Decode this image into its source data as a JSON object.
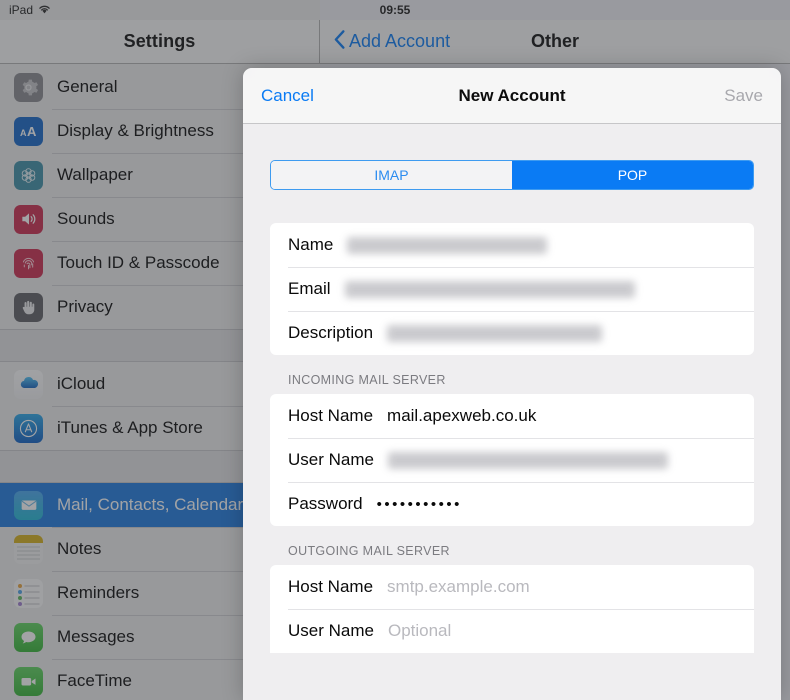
{
  "statusbar": {
    "device": "iPad",
    "wifi_icon": "wifi-icon",
    "time": "09:55"
  },
  "sidebar": {
    "title": "Settings",
    "groups": [
      {
        "items": [
          {
            "label": "General",
            "icon": "gear-icon"
          },
          {
            "label": "Display & Brightness",
            "icon": "display-brightness-icon"
          },
          {
            "label": "Wallpaper",
            "icon": "wallpaper-icon"
          },
          {
            "label": "Sounds",
            "icon": "speaker-icon"
          },
          {
            "label": "Touch ID & Passcode",
            "icon": "fingerprint-icon"
          },
          {
            "label": "Privacy",
            "icon": "hand-icon"
          }
        ]
      },
      {
        "items": [
          {
            "label": "iCloud",
            "icon": "cloud-icon"
          },
          {
            "label": "iTunes & App Store",
            "icon": "app-store-icon"
          }
        ]
      },
      {
        "items": [
          {
            "label": "Mail, Contacts, Calendars",
            "icon": "mail-icon",
            "selected": true
          },
          {
            "label": "Notes",
            "icon": "notes-icon"
          },
          {
            "label": "Reminders",
            "icon": "reminders-icon"
          },
          {
            "label": "Messages",
            "icon": "messages-icon"
          },
          {
            "label": "FaceTime",
            "icon": "facetime-icon"
          }
        ]
      }
    ]
  },
  "detail_nav": {
    "back_icon": "chevron-left-icon",
    "back_label": "Add Account",
    "title": "Other"
  },
  "modal": {
    "cancel_label": "Cancel",
    "title": "New Account",
    "save_label": "Save",
    "segmented": {
      "options": [
        "IMAP",
        "POP"
      ],
      "selected": "POP"
    },
    "account_fields": [
      {
        "label": "Name",
        "value": "",
        "redacted": true,
        "redact_width": 200
      },
      {
        "label": "Email",
        "value": "",
        "redacted": true,
        "redact_width": 290
      },
      {
        "label": "Description",
        "value": "",
        "redacted": true,
        "redact_width": 215
      }
    ],
    "incoming": {
      "header": "Incoming Mail Server",
      "fields": [
        {
          "label": "Host Name",
          "value": "mail.apexweb.co.uk",
          "redacted": false
        },
        {
          "label": "User Name",
          "value": "",
          "redacted": true,
          "redact_width": 280
        },
        {
          "label": "Password",
          "value": "•••••••••••",
          "redacted": false,
          "dots": true
        }
      ]
    },
    "outgoing": {
      "header": "Outgoing Mail Server",
      "fields": [
        {
          "label": "Host Name",
          "value": "smtp.example.com",
          "placeholder": true
        },
        {
          "label": "User Name",
          "value": "Optional",
          "placeholder": true
        }
      ]
    }
  },
  "colors": {
    "accent_blue": "#0a7bf4",
    "selected_row": "#1f7ae0",
    "modal_bg": "#efeef0",
    "placeholder_gray": "#b9b9be"
  }
}
